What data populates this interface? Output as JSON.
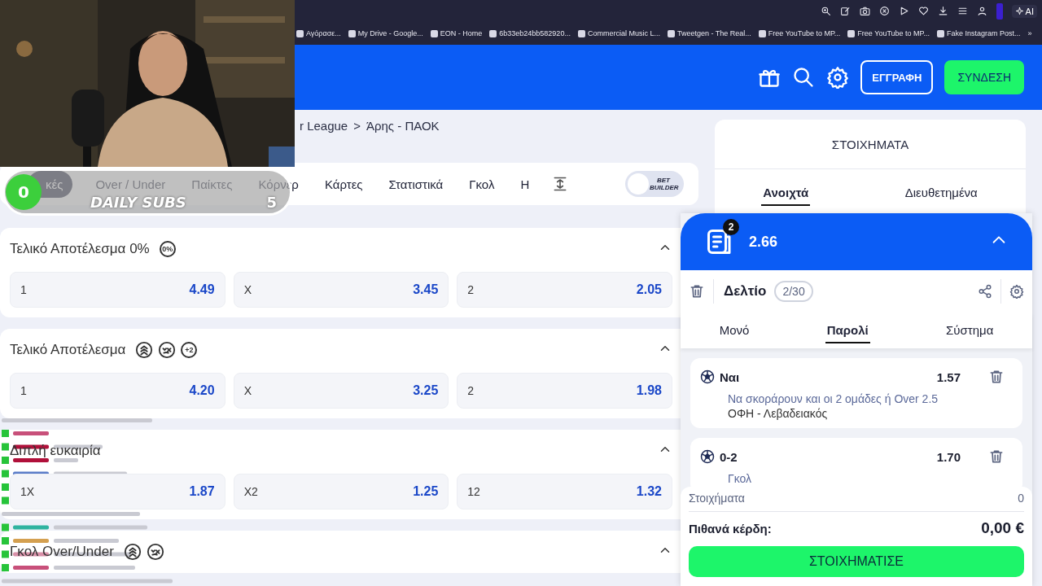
{
  "browser": {
    "bookmarks": [
      {
        "label": "Αγόρασε..."
      },
      {
        "label": "My Drive - Google..."
      },
      {
        "label": "EON - Home"
      },
      {
        "label": "6b33eb24bb582920..."
      },
      {
        "label": "Commercial Music L..."
      },
      {
        "label": "Tweetgen - The Real..."
      },
      {
        "label": "Free YouTube to MP..."
      },
      {
        "label": "Free YouTube to MP..."
      },
      {
        "label": "Fake Instagram Post..."
      }
    ],
    "more": "»",
    "ai_label": "AI"
  },
  "header": {
    "register": "ΕΓΓΡΑΦΗ",
    "login": "ΣΥΝΔΕΣΗ"
  },
  "breadcrumb": {
    "items": [
      "r League",
      "Άρης - ΠΑΟΚ"
    ],
    "separator": ">"
  },
  "market_tabs": [
    {
      "label": "κές",
      "selected": true
    },
    {
      "label": "Over / Under",
      "selected": false
    },
    {
      "label": "Παίκτες",
      "selected": false
    },
    {
      "label": "Κόρνερ",
      "selected": false
    },
    {
      "label": "Κάρτες",
      "selected": false
    },
    {
      "label": "Στατιστικά",
      "selected": false
    },
    {
      "label": "Γκολ",
      "selected": false
    },
    {
      "label": "Η",
      "selected": false
    }
  ],
  "bet_builder": {
    "label": "BET BUILDER",
    "on": false
  },
  "markets": [
    {
      "title": "Τελικό Αποτέλεσμα 0%",
      "expanded": true,
      "icons": [
        {
          "kind": "text",
          "text": "0%"
        }
      ],
      "options": [
        {
          "label": "1",
          "odds": "4.49"
        },
        {
          "label": "X",
          "odds": "3.45"
        },
        {
          "label": "2",
          "odds": "2.05"
        }
      ]
    },
    {
      "title": "Τελικό Αποτέλεσμα",
      "expanded": true,
      "icons": [
        {
          "kind": "boost"
        },
        {
          "kind": "cashout"
        },
        {
          "kind": "text",
          "text": "+2"
        }
      ],
      "options": [
        {
          "label": "1",
          "odds": "4.20"
        },
        {
          "label": "X",
          "odds": "3.25"
        },
        {
          "label": "2",
          "odds": "1.98"
        }
      ]
    },
    {
      "title": "Διπλή ευκαιρία",
      "expanded": true,
      "options": [
        {
          "label": "1X",
          "odds": "1.87"
        },
        {
          "label": "X2",
          "odds": "1.25"
        },
        {
          "label": "12",
          "odds": "1.32"
        }
      ]
    },
    {
      "title": "Γκολ Over/Under",
      "expanded": true,
      "icons": [
        {
          "kind": "boost"
        },
        {
          "kind": "cashout"
        }
      ]
    }
  ],
  "bets_panel": {
    "title": "ΣΤΟΙΧΗΜΑΤΑ",
    "tabs": [
      {
        "label": "Ανοιχτά",
        "selected": true
      },
      {
        "label": "Διευθετημένα",
        "selected": false
      }
    ]
  },
  "betslip": {
    "count": "2",
    "total_odds": "2.66",
    "expanded": true,
    "title": "Δελτίο",
    "capacity": "2/30",
    "tabs": [
      {
        "label": "Μονό",
        "selected": false
      },
      {
        "label": "Παρολί",
        "selected": true
      },
      {
        "label": "Σύστημα",
        "selected": false
      }
    ],
    "selections": [
      {
        "pick": "Ναι",
        "odds": "1.57",
        "market": "Να σκοράρουν και οι 2 ομάδες ή Over 2.5",
        "match": "ΟΦΗ - Λεβαδειακός"
      },
      {
        "pick": "0-2",
        "odds": "1.70",
        "market": "Γκολ"
      }
    ],
    "stakes_label": "Στοιχήματα",
    "stakes_value": "0",
    "winnings_label": "Πιθανά κέρδη:",
    "winnings_value": "0,00 €",
    "place_button": "ΣΤΟΙΧΗΜΑΤΙΣΕ"
  },
  "stream": {
    "subs_goal": {
      "current": "0",
      "label": "DAILY SUBS",
      "target": "5"
    }
  }
}
